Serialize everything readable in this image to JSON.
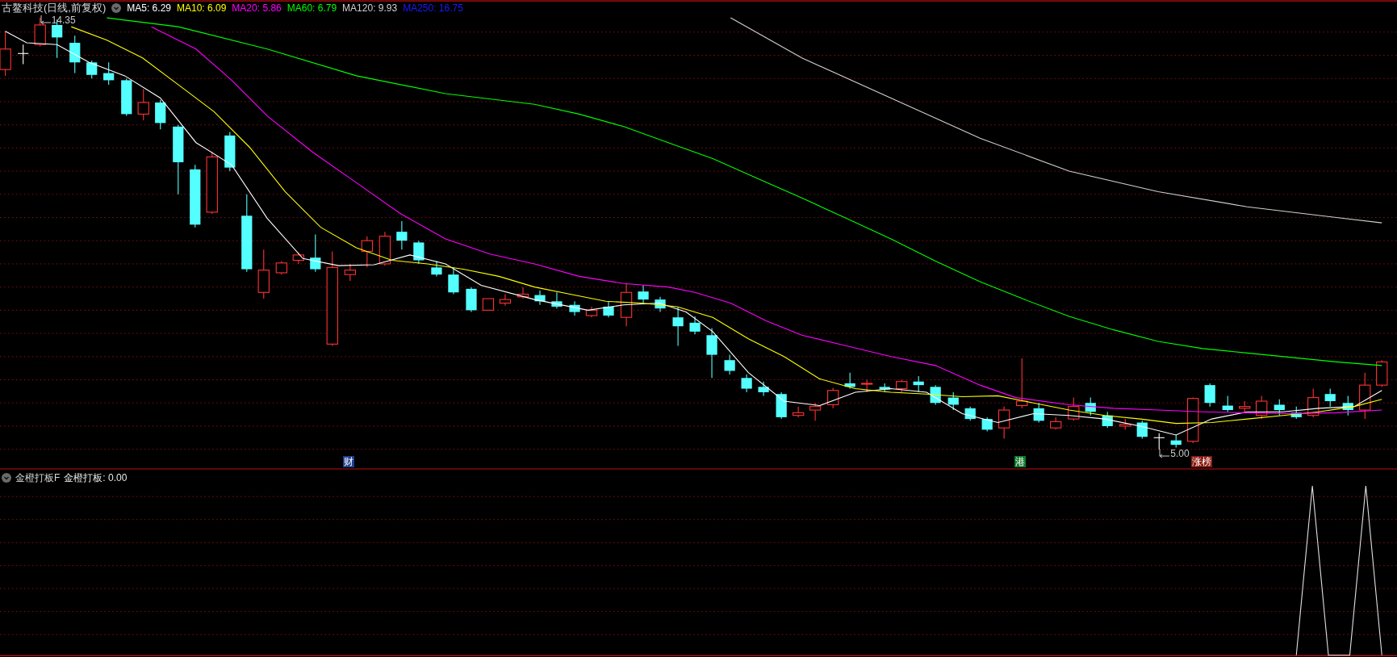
{
  "main_panel": {
    "title": "古鳌科技(日线,前复权)",
    "ma_readings": [
      {
        "text": "MA5: 6.29",
        "color": "#ffffff"
      },
      {
        "text": "MA10: 6.09",
        "color": "#ffff00"
      },
      {
        "text": "MA20: 5.86",
        "color": "#ff00ff"
      },
      {
        "text": "MA60: 6.79",
        "color": "#00ff00"
      },
      {
        "text": "MA120: 9.93",
        "color": "#d0d0d0"
      },
      {
        "text": "MA250: 16.75",
        "color": "#1a1aff"
      }
    ],
    "high_label": "14.35",
    "low_label": "5.00",
    "event_tags": [
      {
        "text": "财",
        "color": "#1f3f8f"
      },
      {
        "text": "港",
        "color": "#0f7a2a"
      },
      {
        "text": "涨榜",
        "color": "#8a1a10"
      }
    ]
  },
  "indicator_panel": {
    "name": "金橙打板F",
    "reading": "金橙打板: 0.00"
  }
}
